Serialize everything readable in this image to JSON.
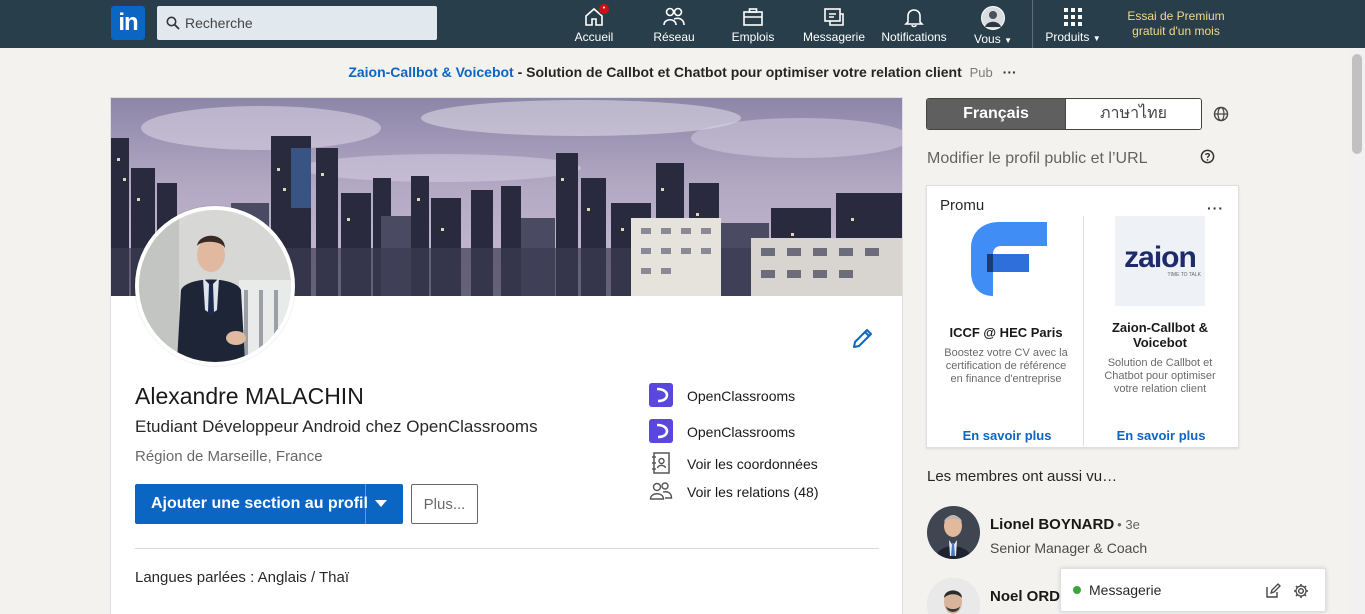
{
  "nav": {
    "logo_text": "in",
    "search_placeholder": "Recherche",
    "items": [
      {
        "label": "Accueil",
        "icon": "home-icon"
      },
      {
        "label": "Réseau",
        "icon": "network-icon"
      },
      {
        "label": "Emplois",
        "icon": "briefcase-icon"
      },
      {
        "label": "Messagerie",
        "icon": "messaging-icon"
      },
      {
        "label": "Notifications",
        "icon": "bell-icon"
      },
      {
        "label": "Vous",
        "icon": "avatar"
      },
      {
        "label": "Produits",
        "icon": "grid-icon"
      }
    ],
    "premium_line1": "Essai de Premium",
    "premium_line2": "gratuit d'un mois"
  },
  "ad": {
    "advertiser": "Zaion-Callbot & Voicebot",
    "text": " - Solution de Callbot et Chatbot pour optimiser votre relation client",
    "pub": "Pub",
    "dots": "···"
  },
  "profile": {
    "name": "Alexandre MALACHIN",
    "headline": "Etudiant Développeur Android chez OpenClassrooms",
    "location": "Région de Marseille, France",
    "add_section_label": "Ajouter une section au profil",
    "more_label": "Plus...",
    "side": {
      "company": "OpenClassrooms",
      "school": "OpenClassrooms",
      "contact": "Voir les coordonnées",
      "connections": "Voir les relations (48)"
    },
    "languages": "Langues parlées : Anglais / Thaï"
  },
  "right": {
    "lang_active": "Français",
    "lang_other": "ภาษาไทย",
    "edit_public": "Modifier le profil public et l’URL",
    "promo": {
      "title": "Promu",
      "dots": "···",
      "items": [
        {
          "name": "ICCF @ HEC Paris",
          "desc": "Boostez votre CV avec la certification de référence en finance d'entreprise",
          "cta": "En savoir plus"
        },
        {
          "name": "Zaion-Callbot & Voicebot",
          "desc": "Solution de Callbot et Chatbot pour optimiser votre relation client",
          "cta": "En savoir plus",
          "logo_text": "zaion",
          "logo_tagline": "TIME TO TALK"
        }
      ]
    },
    "also_viewed": "Les membres ont aussi vu…",
    "people": [
      {
        "name": "Lionel BOYNARD",
        "degree": "• 3e",
        "title": "Senior Manager & Coach"
      },
      {
        "name": "Noel ORD",
        "degree": "",
        "title": ""
      }
    ],
    "messaging": "Messagerie"
  },
  "colors": {
    "nav_bg": "#283e4a",
    "brand_blue": "#0a66c2",
    "premium_gold": "#f5d88a",
    "openclassrooms_purple": "#5a47db"
  }
}
